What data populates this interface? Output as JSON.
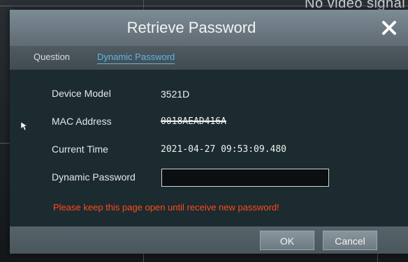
{
  "background": {
    "overlay_text": "No video signal"
  },
  "dialog": {
    "title": "Retrieve Password",
    "tabs": [
      {
        "label": "Question",
        "active": false
      },
      {
        "label": "Dynamic Password",
        "active": true
      }
    ],
    "fields": {
      "device_model": {
        "label": "Device Model",
        "value": "3521D"
      },
      "mac_address": {
        "label": "MAC Address",
        "value": "0018AEAD416A"
      },
      "current_time": {
        "label": "Current Time",
        "value": "2021-04-27 09:53:09.480"
      },
      "dynamic_password": {
        "label": "Dynamic Password",
        "value": ""
      }
    },
    "warning": "Please keep this page open until receive new password!",
    "buttons": {
      "ok": "OK",
      "cancel": "Cancel"
    }
  },
  "colors": {
    "accent_tab": "#5fb6e6",
    "warning": "#ff4a1c",
    "dialog_body": "#1c2b2f",
    "titlebar": "#6e7b84"
  },
  "icons": {
    "close": "close-icon",
    "cursor": "mouse-pointer-icon"
  }
}
